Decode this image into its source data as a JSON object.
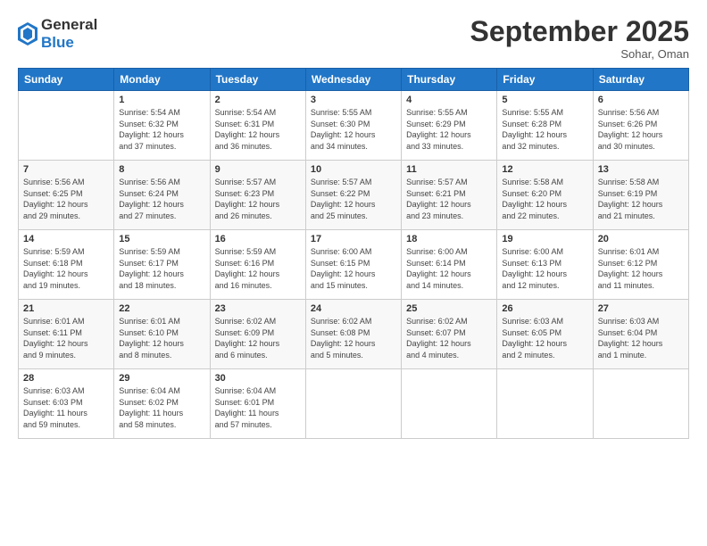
{
  "header": {
    "logo_general": "General",
    "logo_blue": "Blue",
    "month_title": "September 2025",
    "location": "Sohar, Oman"
  },
  "days_of_week": [
    "Sunday",
    "Monday",
    "Tuesday",
    "Wednesday",
    "Thursday",
    "Friday",
    "Saturday"
  ],
  "weeks": [
    [
      {
        "day": "",
        "info": ""
      },
      {
        "day": "1",
        "info": "Sunrise: 5:54 AM\nSunset: 6:32 PM\nDaylight: 12 hours\nand 37 minutes."
      },
      {
        "day": "2",
        "info": "Sunrise: 5:54 AM\nSunset: 6:31 PM\nDaylight: 12 hours\nand 36 minutes."
      },
      {
        "day": "3",
        "info": "Sunrise: 5:55 AM\nSunset: 6:30 PM\nDaylight: 12 hours\nand 34 minutes."
      },
      {
        "day": "4",
        "info": "Sunrise: 5:55 AM\nSunset: 6:29 PM\nDaylight: 12 hours\nand 33 minutes."
      },
      {
        "day": "5",
        "info": "Sunrise: 5:55 AM\nSunset: 6:28 PM\nDaylight: 12 hours\nand 32 minutes."
      },
      {
        "day": "6",
        "info": "Sunrise: 5:56 AM\nSunset: 6:26 PM\nDaylight: 12 hours\nand 30 minutes."
      }
    ],
    [
      {
        "day": "7",
        "info": "Sunrise: 5:56 AM\nSunset: 6:25 PM\nDaylight: 12 hours\nand 29 minutes."
      },
      {
        "day": "8",
        "info": "Sunrise: 5:56 AM\nSunset: 6:24 PM\nDaylight: 12 hours\nand 27 minutes."
      },
      {
        "day": "9",
        "info": "Sunrise: 5:57 AM\nSunset: 6:23 PM\nDaylight: 12 hours\nand 26 minutes."
      },
      {
        "day": "10",
        "info": "Sunrise: 5:57 AM\nSunset: 6:22 PM\nDaylight: 12 hours\nand 25 minutes."
      },
      {
        "day": "11",
        "info": "Sunrise: 5:57 AM\nSunset: 6:21 PM\nDaylight: 12 hours\nand 23 minutes."
      },
      {
        "day": "12",
        "info": "Sunrise: 5:58 AM\nSunset: 6:20 PM\nDaylight: 12 hours\nand 22 minutes."
      },
      {
        "day": "13",
        "info": "Sunrise: 5:58 AM\nSunset: 6:19 PM\nDaylight: 12 hours\nand 21 minutes."
      }
    ],
    [
      {
        "day": "14",
        "info": "Sunrise: 5:59 AM\nSunset: 6:18 PM\nDaylight: 12 hours\nand 19 minutes."
      },
      {
        "day": "15",
        "info": "Sunrise: 5:59 AM\nSunset: 6:17 PM\nDaylight: 12 hours\nand 18 minutes."
      },
      {
        "day": "16",
        "info": "Sunrise: 5:59 AM\nSunset: 6:16 PM\nDaylight: 12 hours\nand 16 minutes."
      },
      {
        "day": "17",
        "info": "Sunrise: 6:00 AM\nSunset: 6:15 PM\nDaylight: 12 hours\nand 15 minutes."
      },
      {
        "day": "18",
        "info": "Sunrise: 6:00 AM\nSunset: 6:14 PM\nDaylight: 12 hours\nand 14 minutes."
      },
      {
        "day": "19",
        "info": "Sunrise: 6:00 AM\nSunset: 6:13 PM\nDaylight: 12 hours\nand 12 minutes."
      },
      {
        "day": "20",
        "info": "Sunrise: 6:01 AM\nSunset: 6:12 PM\nDaylight: 12 hours\nand 11 minutes."
      }
    ],
    [
      {
        "day": "21",
        "info": "Sunrise: 6:01 AM\nSunset: 6:11 PM\nDaylight: 12 hours\nand 9 minutes."
      },
      {
        "day": "22",
        "info": "Sunrise: 6:01 AM\nSunset: 6:10 PM\nDaylight: 12 hours\nand 8 minutes."
      },
      {
        "day": "23",
        "info": "Sunrise: 6:02 AM\nSunset: 6:09 PM\nDaylight: 12 hours\nand 6 minutes."
      },
      {
        "day": "24",
        "info": "Sunrise: 6:02 AM\nSunset: 6:08 PM\nDaylight: 12 hours\nand 5 minutes."
      },
      {
        "day": "25",
        "info": "Sunrise: 6:02 AM\nSunset: 6:07 PM\nDaylight: 12 hours\nand 4 minutes."
      },
      {
        "day": "26",
        "info": "Sunrise: 6:03 AM\nSunset: 6:05 PM\nDaylight: 12 hours\nand 2 minutes."
      },
      {
        "day": "27",
        "info": "Sunrise: 6:03 AM\nSunset: 6:04 PM\nDaylight: 12 hours\nand 1 minute."
      }
    ],
    [
      {
        "day": "28",
        "info": "Sunrise: 6:03 AM\nSunset: 6:03 PM\nDaylight: 11 hours\nand 59 minutes."
      },
      {
        "day": "29",
        "info": "Sunrise: 6:04 AM\nSunset: 6:02 PM\nDaylight: 11 hours\nand 58 minutes."
      },
      {
        "day": "30",
        "info": "Sunrise: 6:04 AM\nSunset: 6:01 PM\nDaylight: 11 hours\nand 57 minutes."
      },
      {
        "day": "",
        "info": ""
      },
      {
        "day": "",
        "info": ""
      },
      {
        "day": "",
        "info": ""
      },
      {
        "day": "",
        "info": ""
      }
    ]
  ]
}
